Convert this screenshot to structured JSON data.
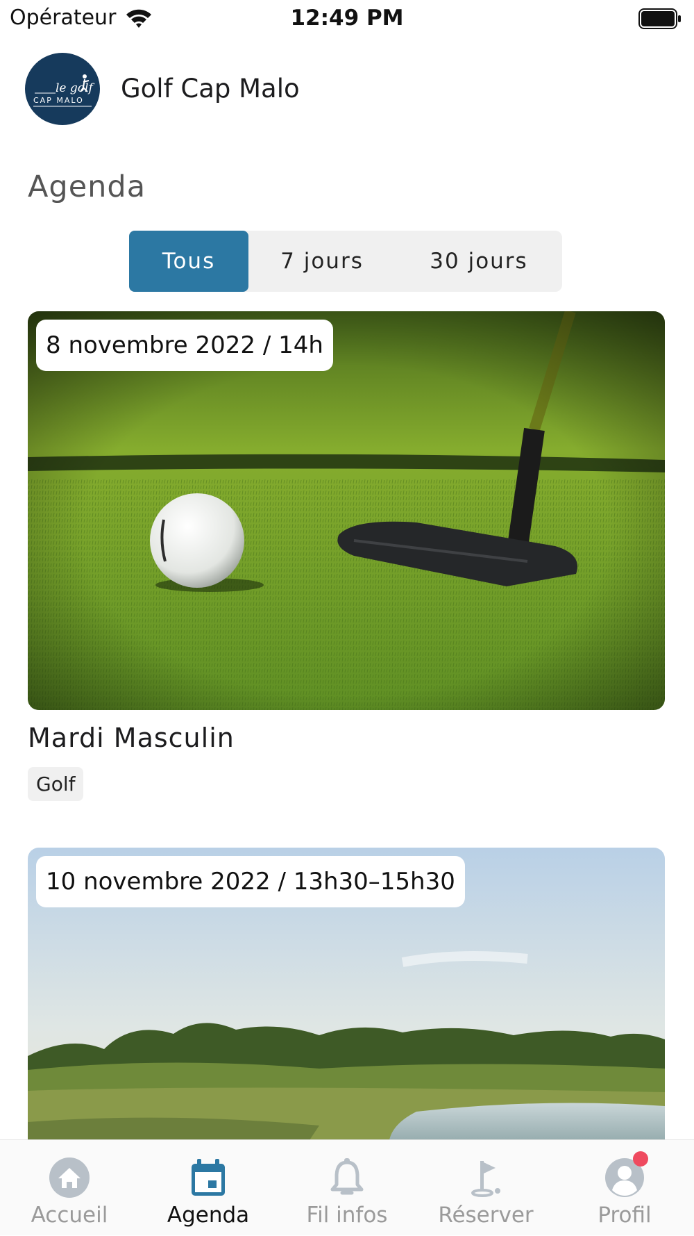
{
  "status_bar": {
    "carrier": "Opérateur",
    "time": "12:49 PM"
  },
  "header": {
    "club_name": "Golf Cap Malo",
    "logo_text_top": "le golf",
    "logo_text_bottom": "CAP MALO"
  },
  "page": {
    "title": "Agenda"
  },
  "filters": {
    "options": [
      "Tous",
      "7 jours",
      "30 jours"
    ],
    "selected": "Tous"
  },
  "events": [
    {
      "date": "8 novembre 2022 / 14h",
      "title": "Mardi Masculin",
      "tag": "Golf",
      "image": "golf-ball-putter-photo"
    },
    {
      "date": "10 novembre 2022 / 13h30–15h30",
      "image": "golf-course-landscape-photo"
    }
  ],
  "tab_bar": {
    "items": [
      {
        "label": "Accueil",
        "icon": "home-icon"
      },
      {
        "label": "Agenda",
        "icon": "calendar-icon"
      },
      {
        "label": "Fil infos",
        "icon": "bell-icon"
      },
      {
        "label": "Réserver",
        "icon": "golf-flag-icon"
      },
      {
        "label": "Profil",
        "icon": "profile-icon"
      }
    ],
    "active": "Agenda"
  },
  "colors": {
    "accent": "#2c78a3",
    "logo_bg": "#163a5c",
    "notification_dot": "#ef4a5f"
  }
}
